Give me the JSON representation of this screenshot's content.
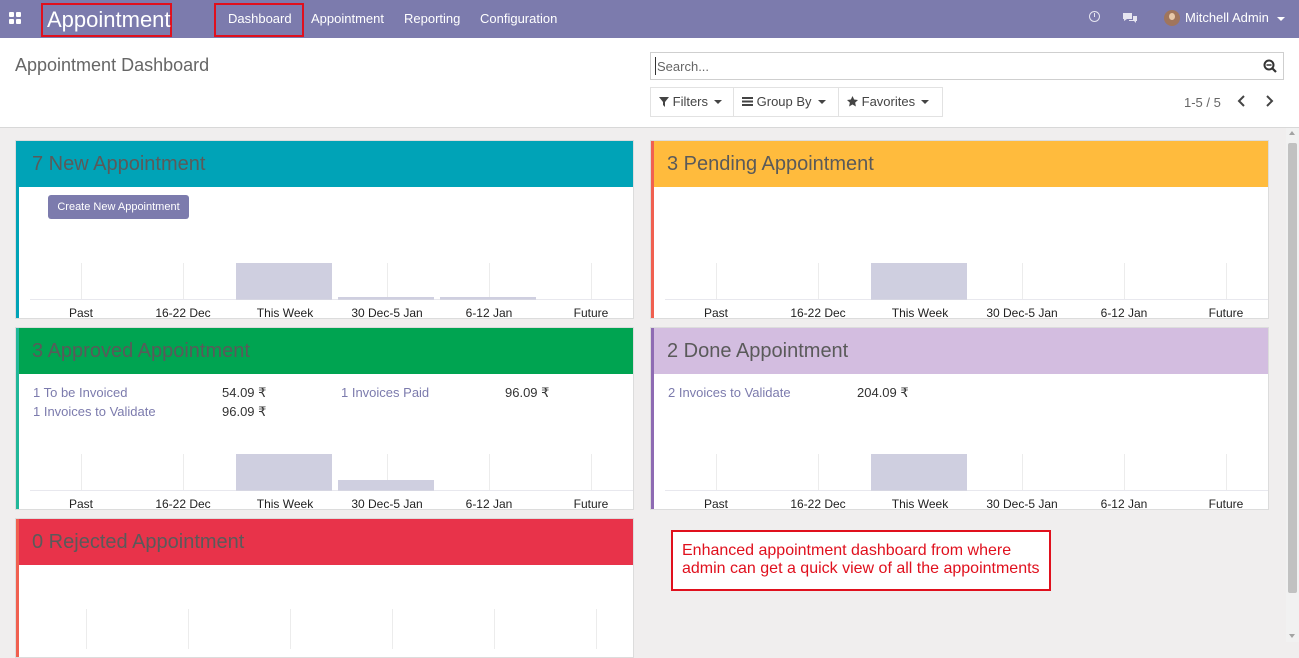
{
  "navbar": {
    "brand": "Appointment",
    "menu": [
      "Dashboard",
      "Appointment",
      "Reporting",
      "Configuration"
    ],
    "user": "Mitchell Admin",
    "icons": [
      "apps-icon",
      "clock-icon",
      "chat-icon",
      "avatar",
      "caret-down-icon"
    ]
  },
  "control": {
    "title": "Appointment Dashboard",
    "search_placeholder": "Search...",
    "filters": "Filters",
    "group_by": "Group By",
    "favorites": "Favorites",
    "pager": "1-5 / 5"
  },
  "cards": {
    "new": {
      "title": "7 New Appointment",
      "color": "#00a3b7",
      "create_button": "Create New Appointment",
      "categories": [
        "Past",
        "16-22 Dec",
        "This Week",
        "30 Dec-5 Jan",
        "6-12 Jan",
        "Future"
      ],
      "values": [
        0,
        0,
        7,
        0.4,
        0.4,
        0
      ]
    },
    "pending": {
      "title": "3 Pending Appointment",
      "color": "#ffbb3d",
      "categories": [
        "Past",
        "16-22 Dec",
        "This Week",
        "30 Dec-5 Jan",
        "6-12 Jan",
        "Future"
      ],
      "values": [
        0,
        0,
        3,
        0,
        0,
        0
      ]
    },
    "approved": {
      "title": "3 Approved Appointment",
      "color": "#00a451",
      "stats": [
        {
          "label": "1 To be Invoiced",
          "value": "54.09 ₹"
        },
        {
          "label": "1 Invoices Paid",
          "value": "96.09 ₹"
        },
        {
          "label": "1 Invoices to Validate",
          "value": "96.09 ₹"
        }
      ],
      "categories": [
        "Past",
        "16-22 Dec",
        "This Week",
        "30 Dec-5 Jan",
        "6-12 Jan",
        "Future"
      ],
      "values": [
        0,
        0,
        3,
        0.8,
        0,
        0
      ]
    },
    "done": {
      "title": "2 Done Appointment",
      "color": "#d3bde0",
      "stats": [
        {
          "label": "2 Invoices to Validate",
          "value": "204.09 ₹"
        }
      ],
      "categories": [
        "Past",
        "16-22 Dec",
        "This Week",
        "30 Dec-5 Jan",
        "6-12 Jan",
        "Future"
      ],
      "values": [
        0,
        0,
        2,
        0,
        0,
        0
      ]
    },
    "rejected": {
      "title": "0 Rejected Appointment",
      "color": "#e8334a"
    }
  },
  "note": "Enhanced appointment dashboard from where admin can get a quick view of all the appointments"
}
